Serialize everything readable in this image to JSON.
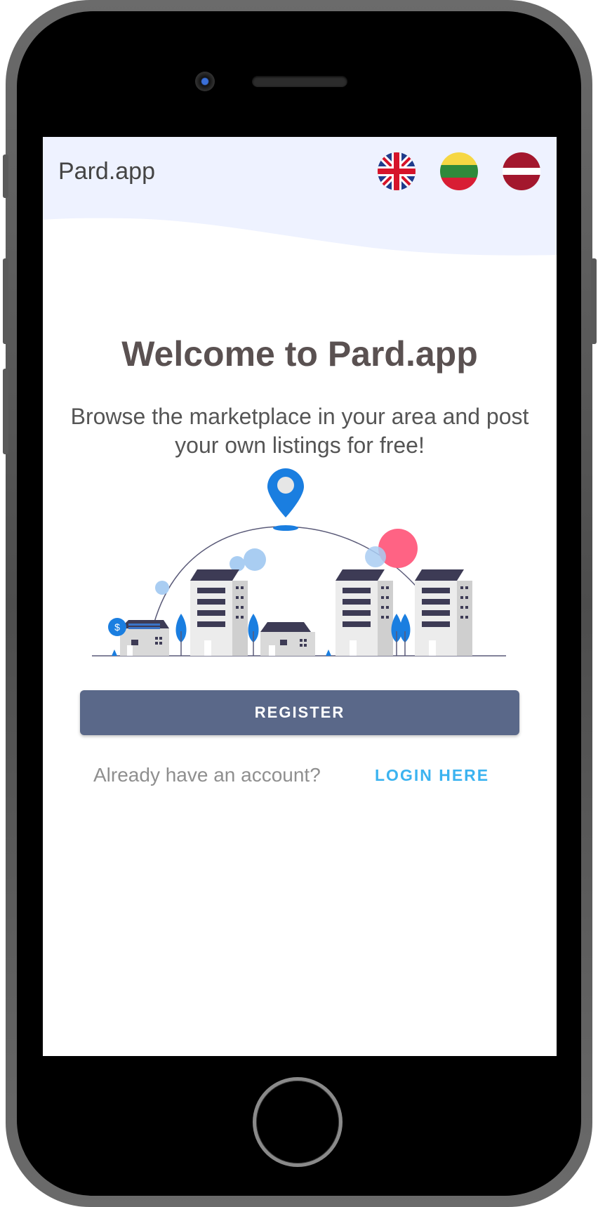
{
  "header": {
    "brand": "Pard.app",
    "languages": [
      {
        "code": "en",
        "icon": "uk-flag-icon"
      },
      {
        "code": "lt",
        "icon": "lithuania-flag-icon"
      },
      {
        "code": "lv",
        "icon": "latvia-flag-icon"
      }
    ]
  },
  "main": {
    "title": "Welcome to Pard.app",
    "subtitle": "Browse the marketplace in your area and post your own listings for free!",
    "illustration_icon": "city-marketplace-illustration",
    "register_label": "REGISTER",
    "account_prompt": "Already have an account?",
    "login_label": "LOGIN HERE"
  },
  "colors": {
    "header_bg": "#eef2ff",
    "register_button": "#5a6889",
    "login_link": "#3bb3f0",
    "title": "#5a5151",
    "accent_blue": "#1a7ee0",
    "accent_pink": "#ff6384"
  }
}
